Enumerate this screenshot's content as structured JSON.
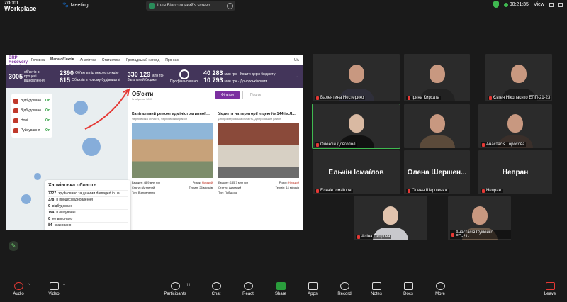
{
  "app": {
    "brand_line1": "zoom",
    "brand_line2": "Workplace",
    "meeting_label": "Meeting"
  },
  "share": {
    "label": "Ілля Білостоцький's screen"
  },
  "topright": {
    "timer": "00:21:35",
    "view": "View"
  },
  "site": {
    "logo": "BRP Recovery Portal",
    "nav": [
      "Головна",
      "Мапа об'єктів",
      "Аналітика",
      "Статистика",
      "Громадський нагляд",
      "Про нас"
    ],
    "lang": "UA",
    "stats": {
      "objects": "3005",
      "objects_label": "об'єктів в процесі відновлення",
      "recon": "2390",
      "recon_label": "Об'єктів під реконструкцію",
      "new": "615",
      "new_label": "Об'єктів в новому будівництві",
      "budget": "330 129",
      "budget_unit": "млн грн",
      "budget_label": "Загальний бюджет",
      "fin_label": "Профінансовано",
      "donor1": "40 283",
      "donor1_label": "млн грн · Кошти держ бюджету",
      "donor2": "10 793",
      "donor2_label": "млн грн · Донорські кошти"
    },
    "legend": [
      {
        "label": "Відбудовано",
        "state": "On"
      },
      {
        "label": "Відбудовано",
        "state": "On"
      },
      {
        "label": "Нові",
        "state": "On"
      },
      {
        "label": "Руйнування",
        "state": "On"
      }
    ],
    "region": {
      "title": "Харківська область",
      "rows": [
        {
          "n": "7727",
          "t": "зруйновано за даними damaged.in.ua"
        },
        {
          "n": "378",
          "t": "в процесі відновлення"
        },
        {
          "n": "0",
          "t": "відбудовано"
        },
        {
          "n": "194",
          "t": "в очікуванні"
        },
        {
          "n": "0",
          "t": "не виконано"
        },
        {
          "n": "84",
          "t": "скасовано"
        }
      ]
    },
    "objects": {
      "title": "Об'єкти",
      "found": "Знайдено: 3005",
      "filter_label": "Фільтри",
      "search_placeholder": "Пошук",
      "cards": [
        {
          "title": "Капітальний ремонт адміністративної ...",
          "sub": "Чернігівська область, Чернігівський район",
          "budget": "Бюджет: 48,9 млн грн",
          "risk_label": "Ризик:",
          "risk": "Низький",
          "status": "Статус: Активний",
          "term": "Термін: 26 місяців",
          "type": "Тип: Відновлення"
        },
        {
          "title": "Укриття на території ліцею № 144 ім.Л...",
          "sub": "Дніпропетровська область, Дніпровський район",
          "budget": "Бюджет: 135,7 млн грн",
          "risk_label": "Ризик:",
          "risk": "Низький",
          "status": "Статус: Активний",
          "term": "Термін: 14 місяців",
          "type": "Тип: Побудова"
        }
      ]
    }
  },
  "participants": [
    "Валентина Нестерико",
    "Ірина Кирхата",
    "Євген Ніколаєнко ЕПП-21-23",
    "Олексій Довгопол",
    "",
    "Анастасія Горохова",
    "Ельчін Ісмаїлов",
    "Олена Шершенюк",
    "Непран",
    "Аліна Петрова",
    "Анастасія Суменко ЕП-21-..."
  ],
  "text_tiles": {
    "t1": "Ельчін Ісмаїлов",
    "t2": "Олена Шершен...",
    "t3": "Непран"
  },
  "toolbar": {
    "audio": "Audio",
    "video": "Video",
    "participants": "Participants",
    "participants_count": "11",
    "chat": "Chat",
    "react": "React",
    "share": "Share",
    "apps": "Apps",
    "record": "Record",
    "notes": "Notes",
    "docs": "Docs",
    "more": "More",
    "leave": "Leave"
  },
  "colors": {
    "accent": "#7b2fa0",
    "header": "#43355a",
    "green": "#3fb950",
    "red": "#e53935"
  }
}
